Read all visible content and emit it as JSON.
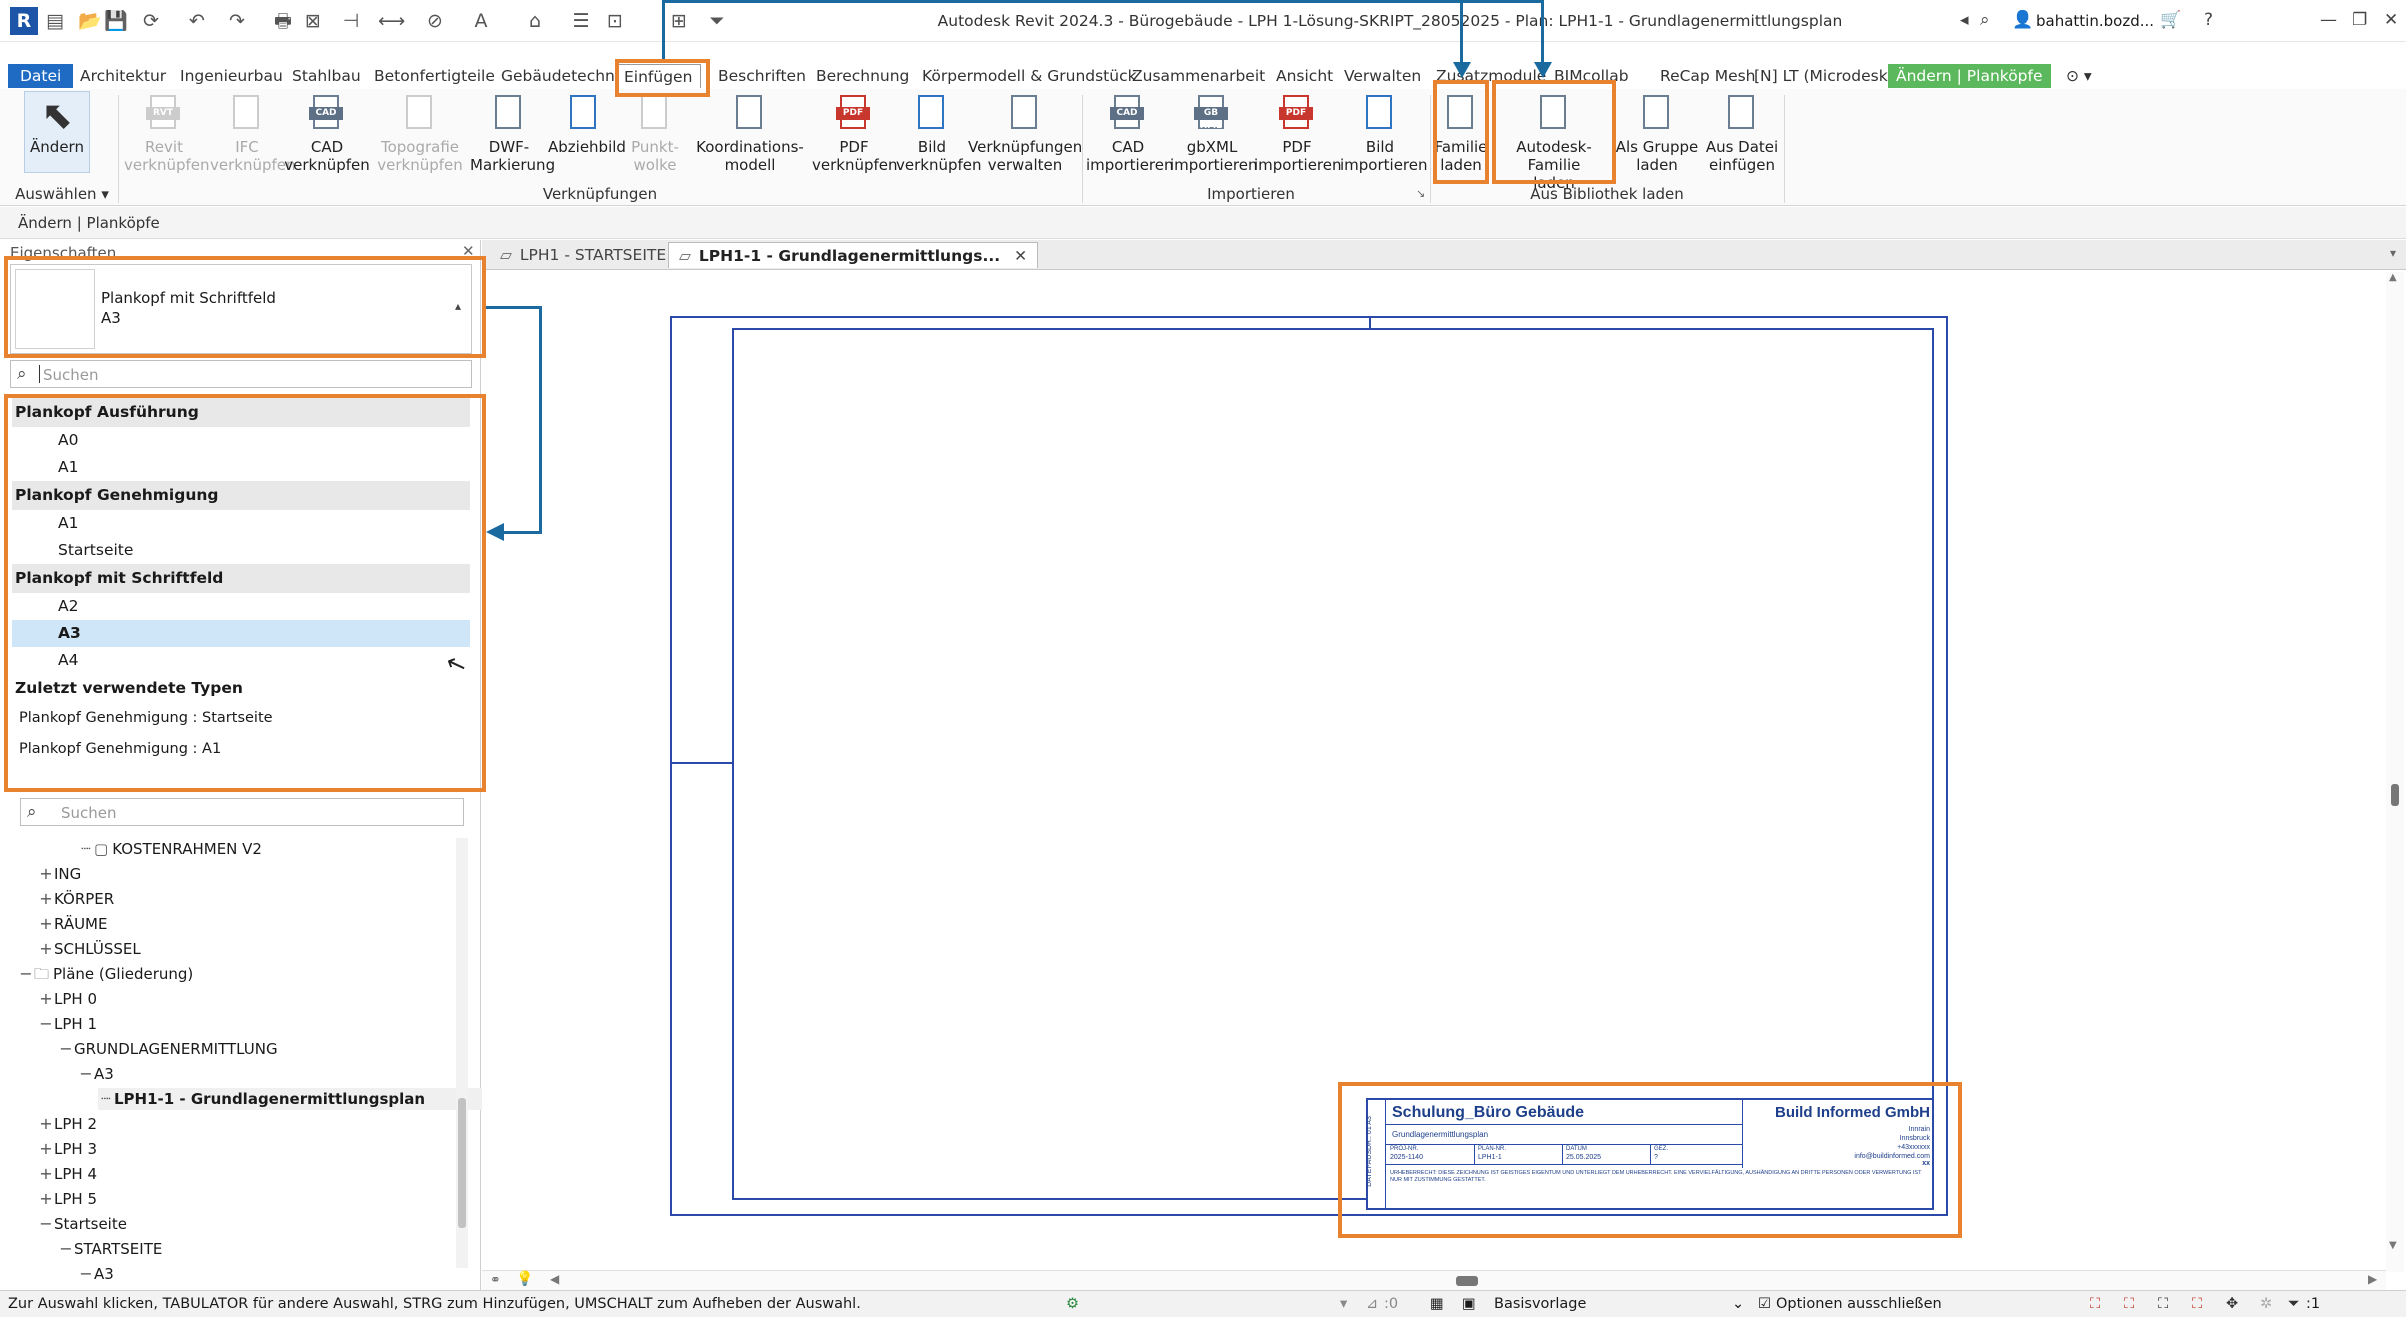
{
  "titlebar": {
    "app_logo": "R",
    "title": "Autodesk Revit 2024.3 - Bürogebäude - LPH 1-Lösung-SKRIPT_28052025 - Plan: LPH1-1 - Grundlagenermittlungsplan",
    "user": "bahattin.bozd...",
    "icons": [
      "open-icon",
      "save-icon",
      "sync-icon",
      "undo-icon",
      "redo-icon",
      "print-icon",
      "measure-icon",
      "text-icon",
      "home-icon",
      "close-view-icon",
      "switch-windows-icon"
    ]
  },
  "ribbon_tabs": [
    "Datei",
    "Architektur",
    "Ingenieurbau",
    "Stahlbau",
    "Betonfertigteile",
    "Gebäudetechnik",
    "Einfügen",
    "Beschriften",
    "Berechnung",
    "Körpermodell & Grundstück",
    "Zusammenarbeit",
    "Ansicht",
    "Verwalten",
    "Zusatzmodule",
    "BIMcollab",
    "ReCap Mesh",
    "[N] LT (Microdesk)",
    "Ändern | Planköpfe"
  ],
  "ribbon": {
    "select_group": {
      "button": "Ändern",
      "label": "Auswählen"
    },
    "links_group": {
      "label": "Verknüpfungen",
      "buttons": [
        {
          "l1": "Revit",
          "l2": "verknüpfen",
          "tag": "RVT",
          "disabled": true
        },
        {
          "l1": "IFC",
          "l2": "verknüpfen",
          "tag": "",
          "disabled": true
        },
        {
          "l1": "CAD",
          "l2": "verknüpfen",
          "tag": "CAD",
          "disabled": false
        },
        {
          "l1": "Topografie",
          "l2": "verknüpfen",
          "tag": "",
          "disabled": true
        },
        {
          "l1": "DWF-",
          "l2": "Markierung",
          "tag": "",
          "disabled": false
        },
        {
          "l1": "Abziehbild",
          "l2": "",
          "tag": "",
          "disabled": false
        },
        {
          "l1": "Punkt-",
          "l2": "wolke",
          "tag": "",
          "disabled": true
        },
        {
          "l1": "Koordinations-",
          "l2": "modell",
          "tag": "",
          "disabled": false
        },
        {
          "l1": "PDF",
          "l2": "verknüpfen",
          "tag": "PDF",
          "disabled": false
        },
        {
          "l1": "Bild",
          "l2": "verknüpfen",
          "tag": "",
          "disabled": false
        },
        {
          "l1": "Verknüpfungen",
          "l2": "verwalten",
          "tag": "",
          "disabled": false
        }
      ]
    },
    "import_group": {
      "label": "Importieren",
      "buttons": [
        {
          "l1": "CAD",
          "l2": "importieren",
          "tag": "CAD"
        },
        {
          "l1": "gbXML",
          "l2": "importieren",
          "tag": "GB XML"
        },
        {
          "l1": "PDF",
          "l2": "importieren",
          "tag": "PDF"
        },
        {
          "l1": "Bild",
          "l2": "importieren",
          "tag": ""
        }
      ]
    },
    "library_group": {
      "label": "Aus Bibliothek laden",
      "buttons": [
        {
          "l1": "Familie",
          "l2": "laden"
        },
        {
          "l1": "Autodesk-Familie",
          "l2": "laden"
        },
        {
          "l1": "Als Gruppe",
          "l2": "laden"
        },
        {
          "l1": "Aus Datei",
          "l2": "einfügen"
        }
      ]
    }
  },
  "context_bar": "Ändern | Planköpfe",
  "properties": {
    "title": "Eigenschaften",
    "type_name": "Plankopf mit Schriftfeld",
    "type_size": "A3",
    "search_placeholder": "Suchen",
    "dropdown": [
      {
        "kind": "head",
        "text": "Plankopf Ausführung"
      },
      {
        "kind": "item",
        "text": "A0"
      },
      {
        "kind": "item",
        "text": "A1"
      },
      {
        "kind": "head",
        "text": "Plankopf Genehmigung"
      },
      {
        "kind": "item",
        "text": "A1"
      },
      {
        "kind": "item",
        "text": "Startseite"
      },
      {
        "kind": "head",
        "text": "Plankopf mit Schriftfeld"
      },
      {
        "kind": "item",
        "text": "A2"
      },
      {
        "kind": "sel",
        "text": "A3"
      },
      {
        "kind": "item",
        "text": "A4"
      },
      {
        "kind": "recenthead",
        "text": "Zuletzt verwendete Typen"
      },
      {
        "kind": "recent",
        "text": "Plankopf Genehmigung : Startseite"
      },
      {
        "kind": "recent",
        "text": "Plankopf Genehmigung : A1"
      }
    ]
  },
  "browser": {
    "search_placeholder": "Suchen",
    "tree": [
      {
        "indent": 3,
        "pm": "",
        "icon": "sheet",
        "text": "KOSTENRAHMEN V2"
      },
      {
        "indent": 1,
        "pm": "+",
        "text": "ING"
      },
      {
        "indent": 1,
        "pm": "+",
        "text": "KÖRPER"
      },
      {
        "indent": 1,
        "pm": "+",
        "text": "RÄUME"
      },
      {
        "indent": 1,
        "pm": "+",
        "text": "SCHLÜSSEL"
      },
      {
        "indent": 0,
        "pm": "−",
        "icon": "folder",
        "text": "Pläne (Gliederung)"
      },
      {
        "indent": 1,
        "pm": "+",
        "text": "LPH 0"
      },
      {
        "indent": 1,
        "pm": "−",
        "text": "LPH 1"
      },
      {
        "indent": 2,
        "pm": "−",
        "text": "GRUNDLAGENERMITTLUNG"
      },
      {
        "indent": 3,
        "pm": "−",
        "text": "A3"
      },
      {
        "indent": 4,
        "pm": "",
        "text": "LPH1-1 - Grundlagenermittlungsplan",
        "bold": true
      },
      {
        "indent": 1,
        "pm": "+",
        "text": "LPH 2"
      },
      {
        "indent": 1,
        "pm": "+",
        "text": "LPH 3"
      },
      {
        "indent": 1,
        "pm": "+",
        "text": "LPH 4"
      },
      {
        "indent": 1,
        "pm": "+",
        "text": "LPH 5"
      },
      {
        "indent": 1,
        "pm": "−",
        "text": "Startseite"
      },
      {
        "indent": 2,
        "pm": "−",
        "text": "STARTSEITE"
      },
      {
        "indent": 3,
        "pm": "−",
        "text": "A3"
      }
    ]
  },
  "doc_tabs": [
    {
      "text": "LPH1 - STARTSEITE",
      "active": false
    },
    {
      "text": "LPH1-1 - Grundlagenermittlungs...",
      "active": true
    }
  ],
  "titleblock": {
    "project": "Schulung_Büro Gebäude",
    "subtitle": "Grundlagenermittlungsplan",
    "company": "Build Informed GmbH",
    "addr1": "Innrain",
    "addr2": "Innsbruck",
    "addr3": "+43xxxxxx",
    "email": "info@buildinformed.com",
    "f1_label": "PROJ-NR.",
    "f1_val": "2025-1140",
    "f2_label": "PLAN-NR.",
    "f2_val": "LPH1-1",
    "f3_label": "DATUM",
    "f3_val": "25.05.2025",
    "f4_label": "GEZ.",
    "f4_val": "?",
    "scale": "xx",
    "legal": "URHEBERRECHT: DIESE ZEICHNUNG IST GEISTIGES EIGENTUM UND UNTERLIEGT DEM URHEBERRECHT. EINE VERVIELFÄLTIGUNG, AUSHÄNDIGUNG AN DRITTE PERSONEN ODER VERWERTUNG IST NUR MIT ZUSTIMMUNG GESTATTET.",
    "side_text": "DATEI-AUSDR.: 01 A3"
  },
  "status": {
    "text": "Zur Auswahl klicken, TABULATOR für andere Auswahl, STRG zum Hinzufügen, UMSCHALT zum Aufheben der Auswahl.",
    "count": ":0",
    "workset": "Basisvorlage",
    "option": "Optionen ausschließen",
    "filter": ":1"
  },
  "colors": {
    "accent_blue": "#1f6bc4",
    "highlight_orange": "#e8822e",
    "annotation_blue": "#1a6aa0",
    "context_green": "#5cb85c",
    "sheet_blue": "#2b4aa8"
  }
}
